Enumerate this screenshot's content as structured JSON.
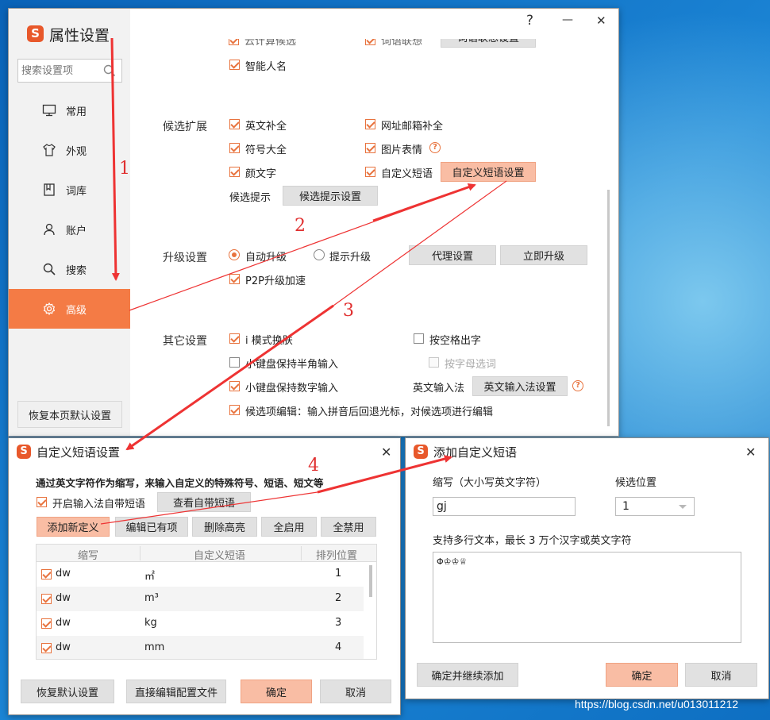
{
  "main": {
    "title": "属性设置",
    "logo": "S",
    "search_placeholder": "搜索设置项",
    "help": "?",
    "min": "—",
    "close": "✕",
    "nav": [
      {
        "label": "常用",
        "icon": "monitor-icon"
      },
      {
        "label": "外观",
        "icon": "shirt-icon"
      },
      {
        "label": "词库",
        "icon": "book-icon"
      },
      {
        "label": "账户",
        "icon": "user-icon"
      },
      {
        "label": "搜索",
        "icon": "search-icon"
      },
      {
        "label": "高级",
        "icon": "gear-icon"
      }
    ],
    "restore": "恢复本页默认设置",
    "top_cut": {
      "a": "云计算候选",
      "b": "词语联想",
      "btn": "词语联想设置"
    },
    "smart_name": "智能人名",
    "cand_ext": {
      "title": "候选扩展",
      "eng": "英文补全",
      "url": "网址邮箱补全",
      "sym": "符号大全",
      "pic": "图片表情",
      "emo": "颜文字",
      "custom": "自定义短语",
      "custom_btn": "自定义短语设置",
      "tip_label": "候选提示",
      "tip_btn": "候选提示设置"
    },
    "upgrade": {
      "title": "升级设置",
      "auto": "自动升级",
      "prompt": "提示升级",
      "proxy_btn": "代理设置",
      "now_btn": "立即升级",
      "p2p": "P2P升级加速"
    },
    "other": {
      "title": "其它设置",
      "imode": "i 模式换肤",
      "space": "按空格出字",
      "half": "小键盘保持半角输入",
      "letter": "按字母选词",
      "numkey": "小键盘保持数字输入",
      "eng_label": "英文输入法",
      "eng_btn": "英文输入法设置",
      "edit": "候选项编辑：输入拼音后回退光标，对候选项进行编辑"
    }
  },
  "custom_dialog": {
    "title": "自定义短语设置",
    "desc": "通过英文字符作为缩写，来输入自定义的特殊符号、短语、短文等",
    "enable": "开启输入法自带短语",
    "view_btn": "查看自带短语",
    "add_btn": "添加新定义",
    "edit_btn": "编辑已有项",
    "del_btn": "删除高亮",
    "enable_all": "全启用",
    "disable_all": "全禁用",
    "columns": [
      "缩写",
      "自定义短语",
      "排列位置"
    ],
    "rows": [
      {
        "abbr": "dw",
        "phrase": "㎡",
        "pos": "1"
      },
      {
        "abbr": "dw",
        "phrase": "m³",
        "pos": "2"
      },
      {
        "abbr": "dw",
        "phrase": "kg",
        "pos": "3"
      },
      {
        "abbr": "dw",
        "phrase": "mm",
        "pos": "4"
      }
    ],
    "restore_btn": "恢复默认设置",
    "direct_btn": "直接编辑配置文件",
    "ok": "确定",
    "cancel": "取消"
  },
  "add_dialog": {
    "title": "添加自定义短语",
    "abbr_label": "缩写（大小写英文字符）",
    "abbr_value": "gj",
    "pos_label": "候选位置",
    "pos_value": "1",
    "multi_label": "支持多行文本，最长 3 万个汉字或英文字符",
    "text_value": "Φ♔♔♕",
    "continue_btn": "确定并继续添加",
    "ok": "确定",
    "cancel": "取消"
  },
  "annotations": {
    "n1": "1",
    "n2": "2",
    "n3": "3",
    "n4": "4"
  },
  "watermark": "https://blog.csdn.net/u013011212",
  "colors": {
    "accent": "#f47b45",
    "highlight": "#f9bda4",
    "arrow": "#ee3333"
  }
}
